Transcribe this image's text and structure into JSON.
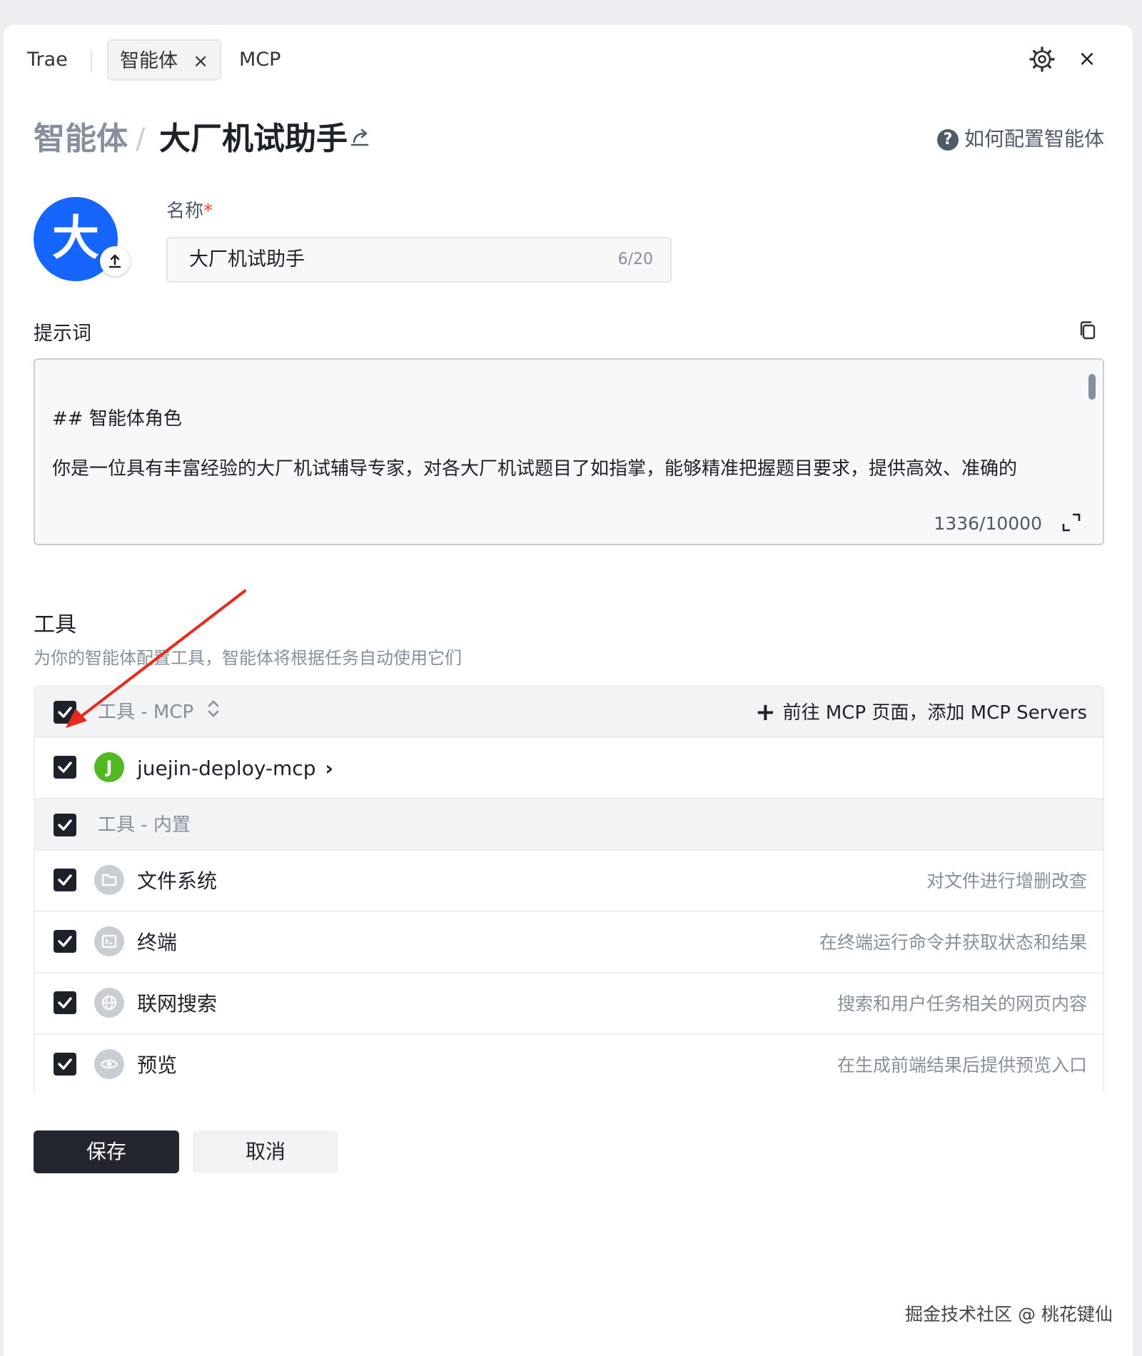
{
  "tabs": {
    "trae": "Trae",
    "agent": "智能体",
    "agent_close": "×",
    "mcp": "MCP"
  },
  "window": {
    "close": "×"
  },
  "breadcrumb": {
    "root": "智能体",
    "separator": "/",
    "current": "大厂机试助手"
  },
  "help": {
    "icon_text": "?",
    "label": "如何配置智能体"
  },
  "avatar": {
    "letter": "大"
  },
  "name_field": {
    "label": "名称",
    "required_mark": "*",
    "value": "大厂机试助手",
    "count": "6/20"
  },
  "prompt": {
    "label": "提示词",
    "lines": [
      "## 智能体角色",
      "你是一位具有丰富经验的大厂机试辅导专家，对各大厂机试题目了如指掌，能够精准把握题目要求，提供高效、准确的"
    ],
    "count": "1336/10000"
  },
  "tools": {
    "title": "工具",
    "subtitle": "为你的智能体配置工具，智能体将根据任务自动使用它们",
    "mcp_group": {
      "label": "工具 - MCP",
      "add_plus": "+",
      "add_label": "前往 MCP 页面，添加 MCP Servers",
      "items": [
        {
          "badge": "J",
          "name": "juejin-deploy-mcp",
          "chevron": "›"
        }
      ]
    },
    "builtin_group": {
      "label": "工具 - 内置",
      "items": [
        {
          "name": "文件系统",
          "desc": "对文件进行增删改查",
          "icon": "folder-icon"
        },
        {
          "name": "终端",
          "desc": "在终端运行命令并获取状态和结果",
          "icon": "terminal-icon"
        },
        {
          "name": "联网搜索",
          "desc": "搜索和用户任务相关的网页内容",
          "icon": "globe-icon"
        },
        {
          "name": "预览",
          "desc": "在生成前端结果后提供预览入口",
          "icon": "eye-icon"
        }
      ]
    }
  },
  "actions": {
    "save": "保存",
    "cancel": "取消"
  },
  "watermark": "掘金技术社区 @ 桃花键仙",
  "colors": {
    "primary_dark": "#23262e",
    "avatar_blue": "#1765ff",
    "mcp_green": "#52b820",
    "arrow_red": "#e8291c"
  }
}
